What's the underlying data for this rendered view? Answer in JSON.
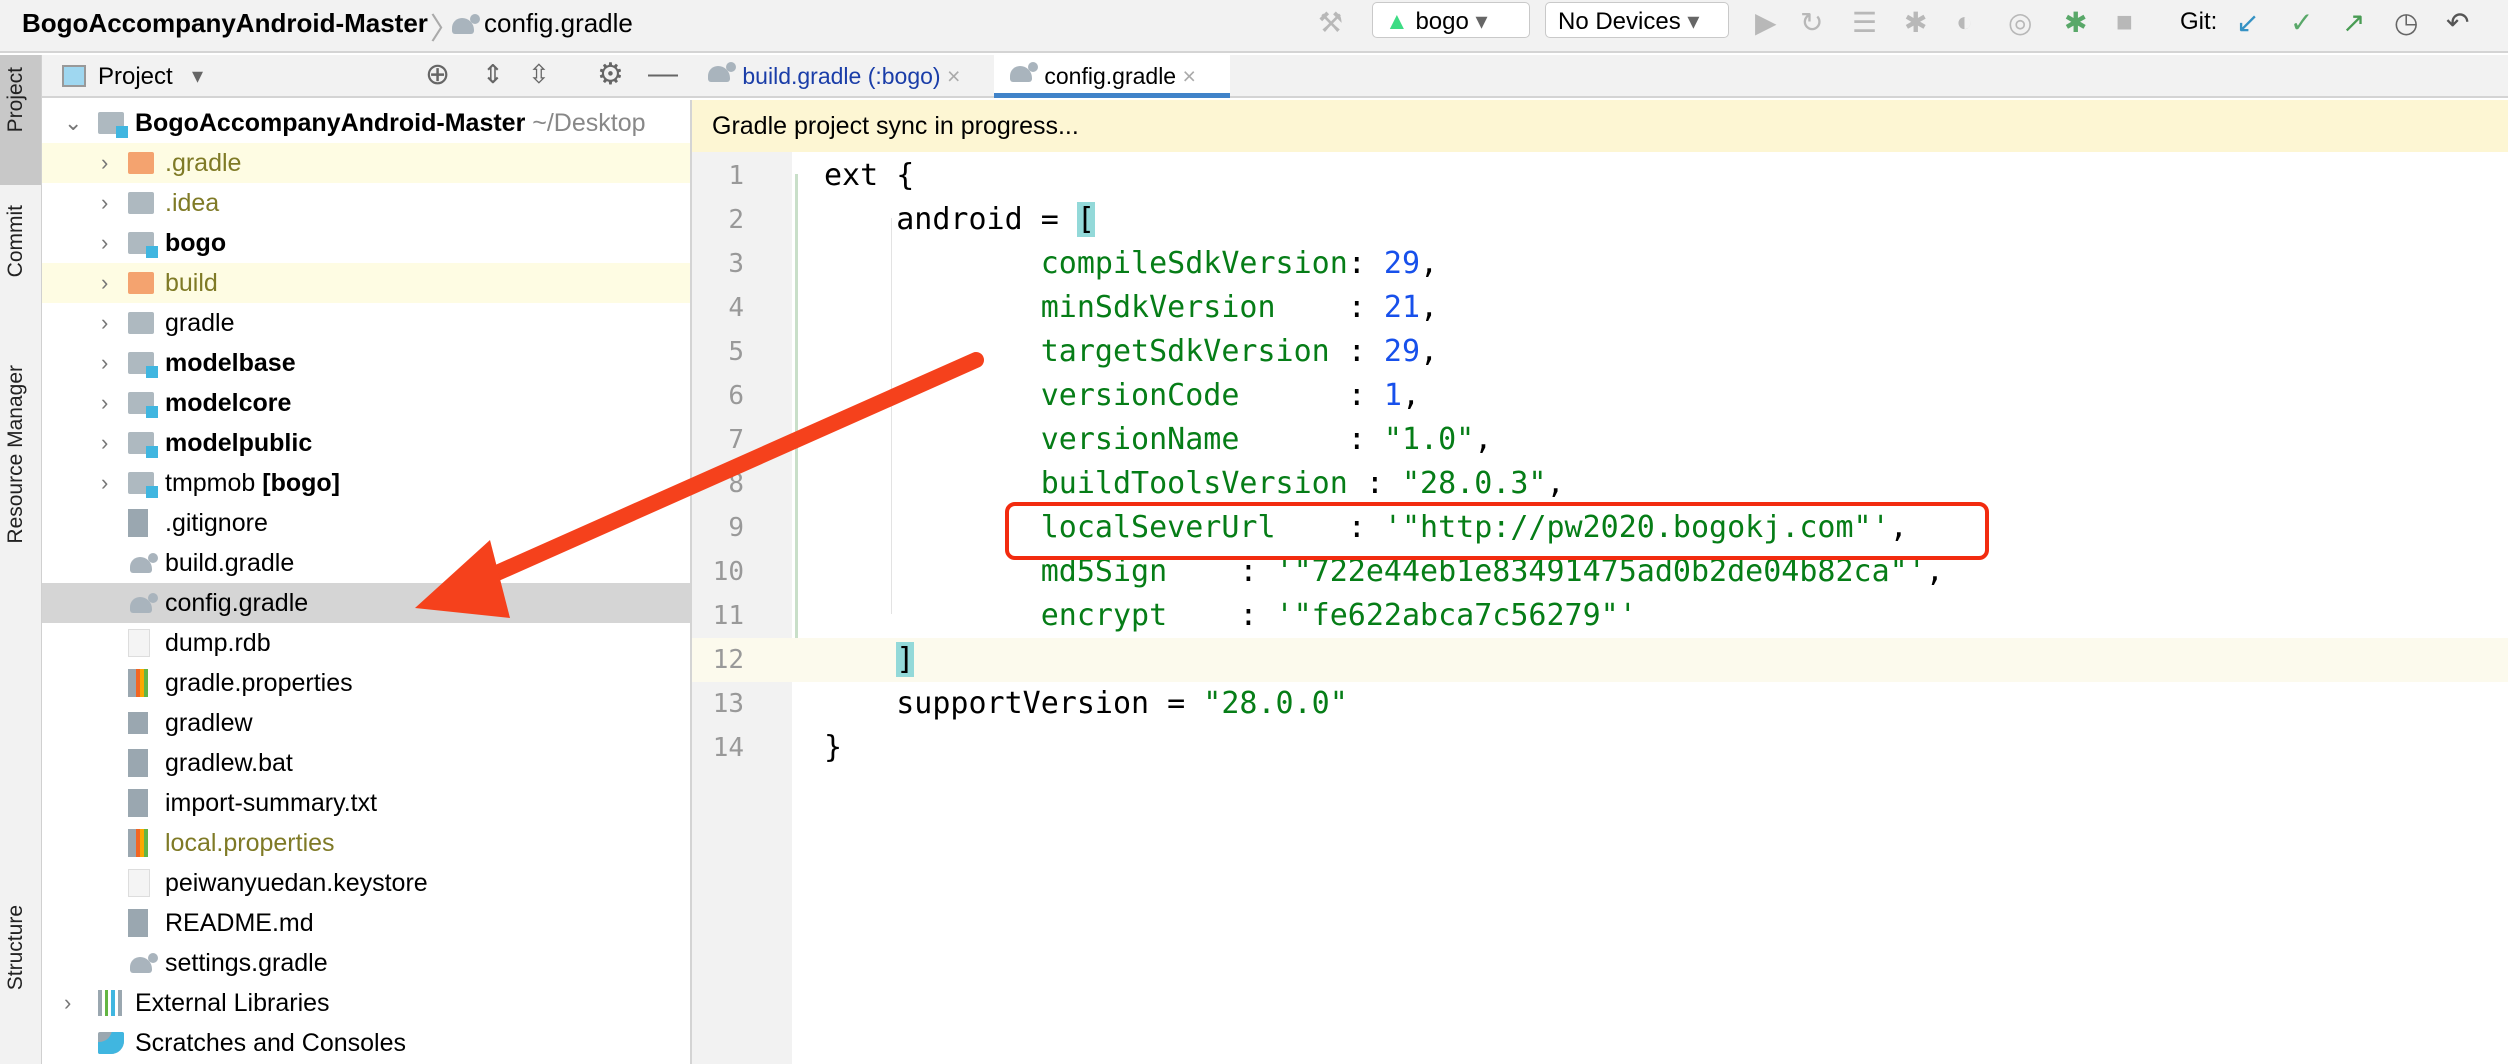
{
  "breadcrumb": {
    "project": "BogoAccompanyAndroid-Master",
    "file": "config.gradle"
  },
  "toolbar": {
    "config": "bogo",
    "device": "No Devices",
    "git_label": "Git:",
    "icons": [
      "hammer-icon",
      "run-icon",
      "apply-changes-icon",
      "apply-code-changes-icon",
      "debug-icon",
      "profile-icon",
      "attach-debugger-icon",
      "sync-gradle-icon",
      "stop-icon"
    ],
    "git_icons": [
      "git-update-icon",
      "git-commit-icon",
      "git-push-icon",
      "git-history-icon",
      "git-rollback-icon"
    ],
    "colors": {
      "git_update": "#3592c4",
      "git_commit": "#59a869",
      "git_push": "#499c54",
      "android": "#3ddc84"
    }
  },
  "left_strip": {
    "tabs": [
      "Project",
      "Commit",
      "Resource Manager",
      "Structure"
    ]
  },
  "project_panel": {
    "title": "Project",
    "tree": [
      {
        "label": "BogoAccompanyAndroid-Master",
        "suffix": "~/Desktop",
        "level": 0,
        "chevron": "down",
        "icon": "module",
        "bold": true
      },
      {
        "label": ".gradle",
        "level": 1,
        "chevron": "right",
        "icon": "folder-excluded",
        "color": "#7f7a26",
        "highlight": true
      },
      {
        "label": ".idea",
        "level": 1,
        "chevron": "right",
        "icon": "folder",
        "color": "#7f7a26"
      },
      {
        "label": "bogo",
        "level": 1,
        "chevron": "right",
        "icon": "module",
        "bold": true
      },
      {
        "label": "build",
        "level": 1,
        "chevron": "right",
        "icon": "folder-excluded",
        "color": "#7f7a26",
        "highlight": true
      },
      {
        "label": "gradle",
        "level": 1,
        "chevron": "right",
        "icon": "folder"
      },
      {
        "label": "modelbase",
        "level": 1,
        "chevron": "right",
        "icon": "module",
        "bold": true
      },
      {
        "label": "modelcore",
        "level": 1,
        "chevron": "right",
        "icon": "module",
        "bold": true
      },
      {
        "label": "modelpublic",
        "level": 1,
        "chevron": "right",
        "icon": "module",
        "bold": true
      },
      {
        "label": "tmpmob",
        "bold_suffix": "[bogo]",
        "level": 1,
        "chevron": "right",
        "icon": "module"
      },
      {
        "label": ".gitignore",
        "level": 1,
        "icon": "gitignore-file"
      },
      {
        "label": "build.gradle",
        "level": 1,
        "icon": "gradle-file"
      },
      {
        "label": "config.gradle",
        "level": 1,
        "icon": "gradle-file",
        "selected": true
      },
      {
        "label": "dump.rdb",
        "level": 1,
        "icon": "file"
      },
      {
        "label": "gradle.properties",
        "level": 1,
        "icon": "properties-file"
      },
      {
        "label": "gradlew",
        "level": 1,
        "icon": "shell-file"
      },
      {
        "label": "gradlew.bat",
        "level": 1,
        "icon": "text-file"
      },
      {
        "label": "import-summary.txt",
        "level": 1,
        "icon": "text-file"
      },
      {
        "label": "local.properties",
        "level": 1,
        "icon": "properties-file",
        "color": "#7f7a26"
      },
      {
        "label": "peiwanyuedan.keystore",
        "level": 1,
        "icon": "file"
      },
      {
        "label": "README.md",
        "level": 1,
        "icon": "text-file"
      },
      {
        "label": "settings.gradle",
        "level": 1,
        "icon": "gradle-file"
      },
      {
        "label": "External Libraries",
        "level": 0,
        "chevron": "right",
        "icon": "libraries"
      },
      {
        "label": "Scratches and Consoles",
        "level": 0,
        "icon": "scratches"
      }
    ]
  },
  "editor": {
    "tabs": [
      {
        "label": "build.gradle (:bogo)",
        "active": false
      },
      {
        "label": "config.gradle",
        "active": true
      }
    ],
    "banner": "Gradle project sync in progress...",
    "current_line": 12,
    "lines": [
      [
        [
          "p",
          "ext {"
        ]
      ],
      [
        [
          "p",
          "    android = "
        ],
        [
          "b",
          "["
        ]
      ],
      [
        [
          "k",
          "            compileSdkVersion"
        ],
        [
          "p",
          ": "
        ],
        [
          "n",
          "29"
        ],
        [
          "p",
          ","
        ]
      ],
      [
        [
          "k",
          "            minSdkVersion    "
        ],
        [
          "p",
          ": "
        ],
        [
          "n",
          "21"
        ],
        [
          "p",
          ","
        ]
      ],
      [
        [
          "k",
          "            targetSdkVersion "
        ],
        [
          "p",
          ": "
        ],
        [
          "n",
          "29"
        ],
        [
          "p",
          ","
        ]
      ],
      [
        [
          "k",
          "            versionCode      "
        ],
        [
          "p",
          ": "
        ],
        [
          "n",
          "1"
        ],
        [
          "p",
          ","
        ]
      ],
      [
        [
          "k",
          "            versionName      "
        ],
        [
          "p",
          ": "
        ],
        [
          "s",
          "\"1.0\""
        ],
        [
          "p",
          ","
        ]
      ],
      [
        [
          "k",
          "            buildToolsVersion "
        ],
        [
          "p",
          ": "
        ],
        [
          "s",
          "\"28.0.3\""
        ],
        [
          "p",
          ","
        ]
      ],
      [
        [
          "k",
          "            localSeverUrl    "
        ],
        [
          "p",
          ": "
        ],
        [
          "s",
          "'\"http://pw2020.bogokj.com\"'"
        ],
        [
          "p",
          ","
        ]
      ],
      [
        [
          "k",
          "            md5Sign    "
        ],
        [
          "p",
          ": "
        ],
        [
          "s",
          "'\"722e44eb1e83491475ad0b2de04b82ca\"'"
        ],
        [
          "p",
          ","
        ]
      ],
      [
        [
          "k",
          "            encrypt    "
        ],
        [
          "p",
          ": "
        ],
        [
          "s",
          "'\"fe622abca7c56279\"'"
        ]
      ],
      [
        [
          "p",
          "    "
        ],
        [
          "b",
          "]"
        ]
      ],
      [
        [
          "p",
          "    supportVersion = "
        ],
        [
          "s",
          "\"28.0.0\""
        ]
      ],
      [
        [
          "p",
          "}"
        ]
      ]
    ]
  },
  "annotation": {
    "color": "#f5411c",
    "highlight_line": 9
  }
}
